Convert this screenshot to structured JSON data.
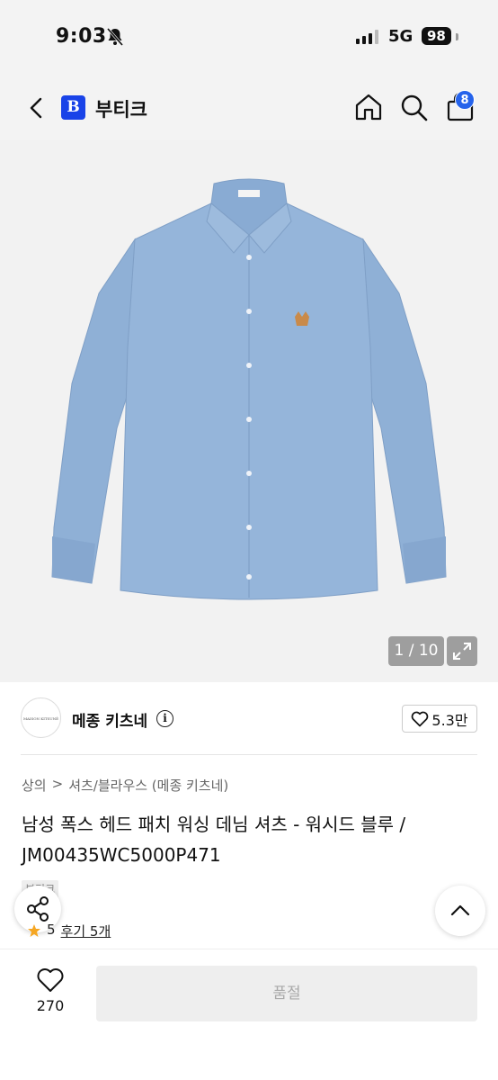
{
  "status": {
    "time": "9:03",
    "network": "5G",
    "battery": "98"
  },
  "nav": {
    "brand_logo": "B",
    "brand_name": "부티크",
    "cart_count": "8",
    "icons": [
      "chevron-left-icon",
      "home-icon",
      "search-icon",
      "shopping-bag-icon"
    ]
  },
  "gallery": {
    "counter": "1 / 10"
  },
  "seller": {
    "logo_text": "MAISON KITSUNÉ",
    "name": "메종 키츠네",
    "info_icon": "i",
    "wishlist_count": "5.3만"
  },
  "breadcrumb": {
    "category": "상의",
    "separator": ">",
    "subcategory": "셔츠/블라우스 (메종 키츠네)"
  },
  "product": {
    "title": "남성 폭스 헤드 패치 워싱 데님 셔츠 - 워시드 블루 / JM00435WC5000P471",
    "tag": "부티크",
    "rating": "5",
    "reviews": "후기 5개"
  },
  "bottom": {
    "like_count": "270",
    "buy_button": "품절"
  },
  "colors": {
    "brand_blue": "#1943e8",
    "badge_blue": "#2563eb",
    "shirt": "#8fb0d6",
    "soldout_bg": "#eeeeee",
    "rating_star": "#f5a623"
  }
}
